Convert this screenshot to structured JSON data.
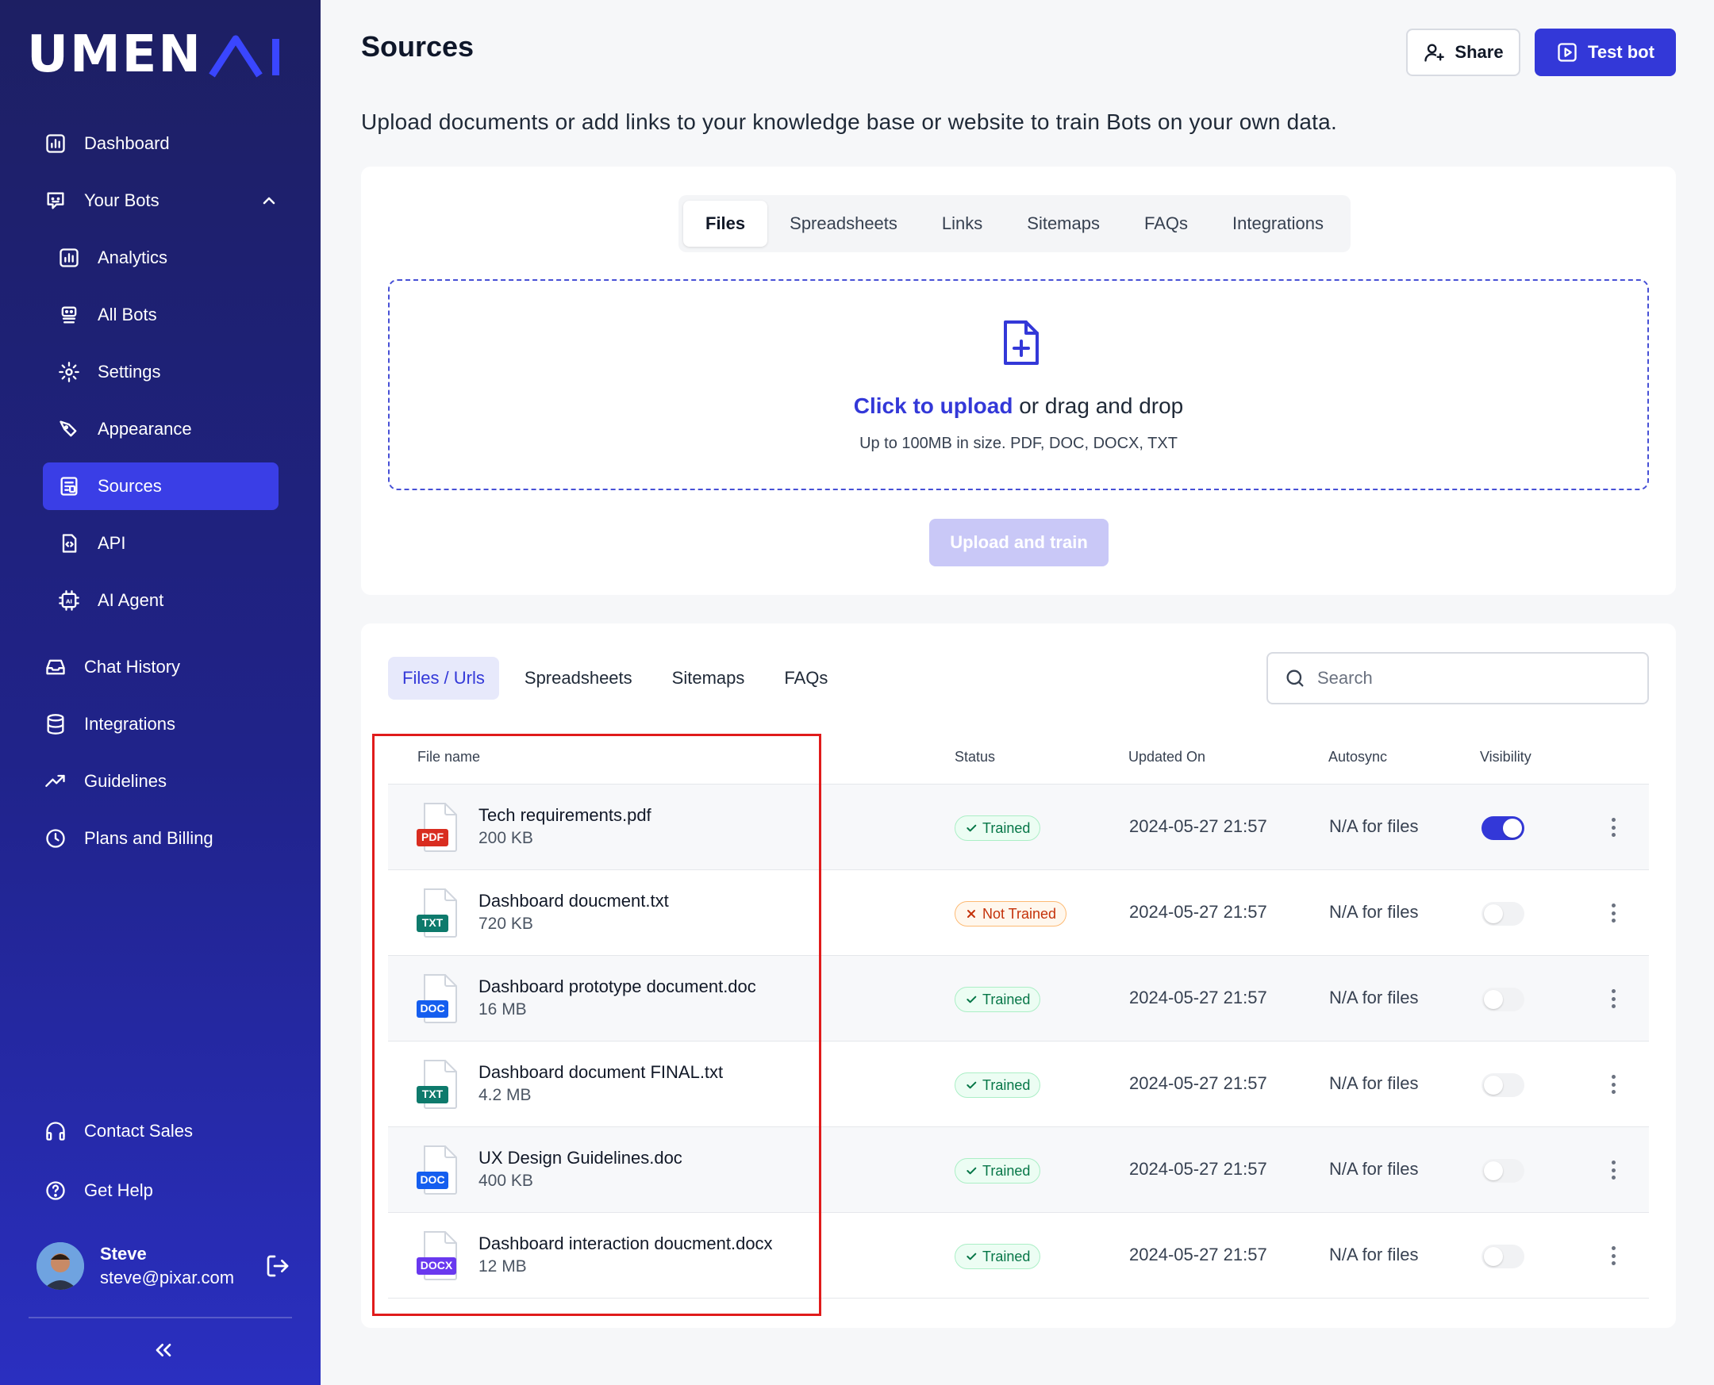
{
  "brand": {
    "logo_text": "UMEN",
    "logo_ai": "AI"
  },
  "sidebar": {
    "items": [
      {
        "label": "Dashboard",
        "icon": "chart-icon"
      },
      {
        "label": "Your Bots",
        "icon": "bot-message-icon"
      },
      {
        "label": "Analytics",
        "icon": "chart-icon"
      },
      {
        "label": "All Bots",
        "icon": "robot-icon"
      },
      {
        "label": "Settings",
        "icon": "gear-icon"
      },
      {
        "label": "Appearance",
        "icon": "brush-icon"
      },
      {
        "label": "Sources",
        "icon": "document-icon"
      },
      {
        "label": "API",
        "icon": "code-file-icon"
      },
      {
        "label": "AI Agent",
        "icon": "chip-icon"
      },
      {
        "label": "Chat History",
        "icon": "inbox-icon"
      },
      {
        "label": "Integrations",
        "icon": "database-icon"
      },
      {
        "label": "Guidelines",
        "icon": "trend-icon"
      },
      {
        "label": "Plans and Billing",
        "icon": "clock-icon"
      },
      {
        "label": "Contact Sales",
        "icon": "headphones-icon"
      },
      {
        "label": "Get Help",
        "icon": "help-icon"
      }
    ],
    "active": "Sources",
    "user": {
      "name": "Steve",
      "email": "steve@pixar.com"
    }
  },
  "header": {
    "title": "Sources",
    "share_label": "Share",
    "test_label": "Test bot",
    "subtitle": "Upload documents or add links to your knowledge base or website to train Bots on your own data."
  },
  "upload": {
    "tabs": [
      "Files",
      "Spreadsheets",
      "Links",
      "Sitemaps",
      "FAQs",
      "Integrations"
    ],
    "active_tab": "Files",
    "click_text": "Click to upload",
    "drag_text": " or drag and drop",
    "hint": "Up to 100MB in size. PDF, DOC, DOCX, TXT",
    "button": "Upload and train"
  },
  "list": {
    "tabs": [
      "Files / Urls",
      "Spreadsheets",
      "Sitemaps",
      "FAQs"
    ],
    "active_tab": "Files / Urls",
    "search_placeholder": "Search",
    "columns": [
      "File name",
      "Status",
      "Updated On",
      "Autosync",
      "Visibility"
    ],
    "rows": [
      {
        "name": "Tech requirements.pdf",
        "size": "200 KB",
        "type": "PDF",
        "type_color": "#d92d20",
        "status": "Trained",
        "updated": "2024-05-27 21:57",
        "autosync": "N/A for files",
        "visible": true
      },
      {
        "name": "Dashboard doucment.txt",
        "size": "720 KB",
        "type": "TXT",
        "type_color": "#0e7a6c",
        "status": "Not Trained",
        "updated": "2024-05-27 21:57",
        "autosync": "N/A for files",
        "visible": false
      },
      {
        "name": "Dashboard prototype document.doc",
        "size": "16 MB",
        "type": "DOC",
        "type_color": "#155eef",
        "status": "Trained",
        "updated": "2024-05-27 21:57",
        "autosync": "N/A for files",
        "visible": false
      },
      {
        "name": "Dashboard document FINAL.txt",
        "size": "4.2 MB",
        "type": "TXT",
        "type_color": "#0e7a6c",
        "status": "Trained",
        "updated": "2024-05-27 21:57",
        "autosync": "N/A for files",
        "visible": false
      },
      {
        "name": "UX Design Guidelines.doc",
        "size": "400 KB",
        "type": "DOC",
        "type_color": "#155eef",
        "status": "Trained",
        "updated": "2024-05-27 21:57",
        "autosync": "N/A for files",
        "visible": false
      },
      {
        "name": "Dashboard interaction doucment.docx",
        "size": "12 MB",
        "type": "DOCX",
        "type_color": "#6938ef",
        "status": "Trained",
        "updated": "2024-05-27 21:57",
        "autosync": "N/A for files",
        "visible": false
      }
    ]
  },
  "colors": {
    "accent": "#3338d8",
    "sidebar": "#1d1f63",
    "highlight": "#e01b1b"
  }
}
